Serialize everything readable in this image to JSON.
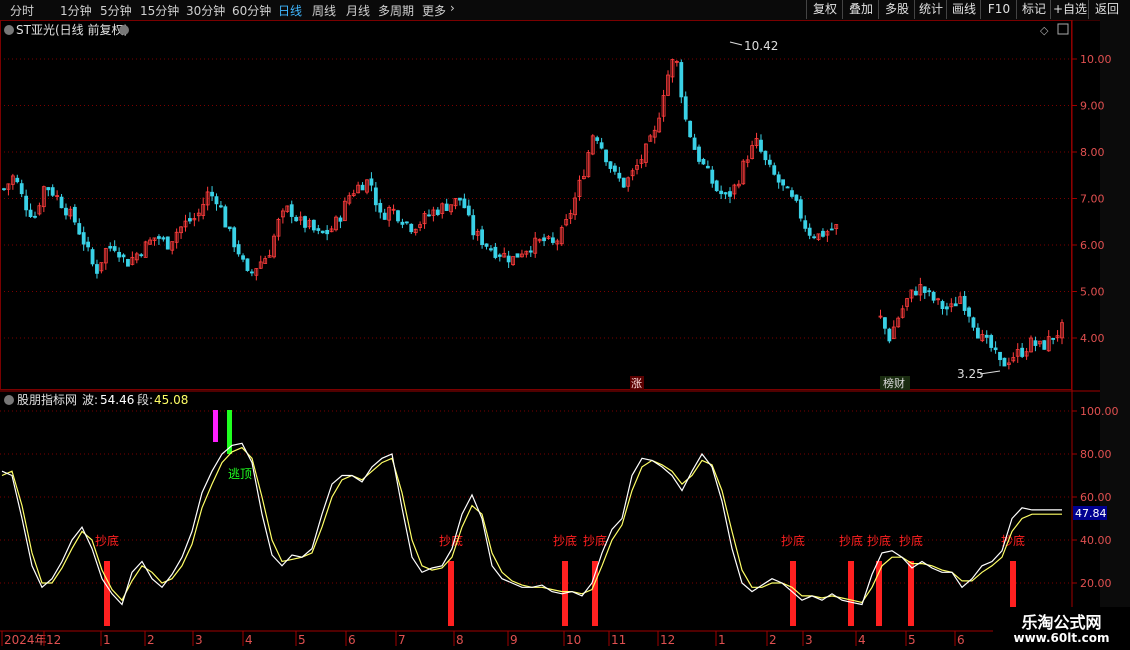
{
  "toolbar": {
    "periods": [
      "分时",
      "1分钟",
      "5分钟",
      "15分钟",
      "30分钟",
      "60分钟",
      "日线",
      "周线",
      "月线",
      "多周期",
      "更多"
    ],
    "active_period": "日线",
    "buttons": [
      "复权",
      "叠加",
      "多股",
      "统计",
      "画线",
      "F10",
      "标记",
      "+自选",
      "返回"
    ]
  },
  "main_panel": {
    "title": "ST亚光(日线 前复权)",
    "high_label": "10.42",
    "low_label": "3.25",
    "event_tag_1": "涨",
    "event_tag_2": "榜财"
  },
  "indicator_panel": {
    "name": "股朋指标网",
    "wave_label": "波:",
    "wave_value": "54.46",
    "segment_label": "段:",
    "segment_value": "45.08",
    "current_value": "47.84",
    "top_signal": "逃顶",
    "bottom_signal": "抄底"
  },
  "colors": {
    "bg": "#000000",
    "grid": "#7a0000",
    "up": "#ff3c3c",
    "down": "#3ad1e6",
    "wave": "#ffffff",
    "segment": "#ffff66",
    "signal_bottom": "#ff2020",
    "signal_top_green": "#20ff20",
    "signal_top_magenta": "#ff20ff"
  },
  "chart_data": [
    {
      "type": "candlestick",
      "title": "ST亚光(日线 前复权)",
      "y_ticks": [
        4.0,
        5.0,
        6.0,
        7.0,
        8.0,
        9.0,
        10.0
      ],
      "ylim": [
        3.0,
        10.8
      ],
      "high": 10.42,
      "low": 3.25,
      "x_tick_labels": [
        "2024年",
        "12",
        "1",
        "2",
        "3",
        "4",
        "5",
        "6",
        "7",
        "8",
        "9",
        "10",
        "11",
        "12",
        "1",
        "2",
        "3",
        "4",
        "5",
        "6"
      ],
      "close_path": [
        7.2,
        7.5,
        6.9,
        6.6,
        7.3,
        7.1,
        6.8,
        6.5,
        6.0,
        5.4,
        5.9,
        6.0,
        5.6,
        5.8,
        6.0,
        6.2,
        6.0,
        6.3,
        6.5,
        6.6,
        7.1,
        7.0,
        6.3,
        5.9,
        5.3,
        5.6,
        5.8,
        6.5,
        6.8,
        6.5,
        6.4,
        6.2,
        6.3,
        6.6,
        7.1,
        7.3,
        7.4,
        6.6,
        6.8,
        6.6,
        6.4,
        6.5,
        6.7,
        6.8,
        6.9,
        7.0,
        6.3,
        6.1,
        5.9,
        5.8,
        5.7,
        5.9,
        6.0,
        6.1,
        6.0,
        6.3,
        6.9,
        7.6,
        8.5,
        8.0,
        7.5,
        7.3,
        7.6,
        8.0,
        8.4,
        9.5,
        10.1,
        8.7,
        8.0,
        7.6,
        7.2,
        7.0,
        7.3,
        7.9,
        8.2,
        7.7,
        7.4,
        7.1,
        6.8,
        6.3,
        6.2,
        6.3,
        6.4,
        null,
        null,
        null,
        4.5,
        4.0,
        4.5,
        4.9,
        5.1,
        4.9,
        4.7,
        4.6,
        4.9,
        4.5,
        4.0,
        3.8,
        3.4,
        3.6,
        3.7,
        3.9,
        3.8,
        4.0,
        4.2
      ]
    },
    {
      "type": "line",
      "title": "股朋指标网",
      "y_ticks": [
        20.0,
        40.0,
        60.0,
        80.0,
        100.0
      ],
      "ylim": [
        5,
        106
      ],
      "current_value": 47.84,
      "series": [
        {
          "name": "波",
          "x": [
            0,
            1,
            2,
            3,
            4,
            5,
            6,
            7,
            8,
            9,
            10,
            11,
            12,
            13,
            14,
            15,
            16,
            17,
            18,
            19,
            20,
            21,
            22,
            23,
            24,
            25,
            26,
            27,
            28,
            29,
            30,
            31,
            32,
            33,
            34,
            35,
            36,
            37,
            38,
            39,
            40,
            41,
            42,
            43,
            44,
            45,
            46,
            47,
            48,
            49,
            50,
            51,
            52,
            53,
            54,
            55,
            56,
            57,
            58,
            59,
            60,
            61,
            62,
            63,
            64,
            65,
            66,
            67,
            68,
            69,
            70,
            71,
            72,
            73,
            74,
            75,
            76,
            77,
            78,
            79,
            80,
            81,
            82,
            83,
            84,
            85,
            86,
            87,
            88,
            89,
            90,
            91,
            92,
            93,
            94,
            95,
            96,
            97,
            98,
            99,
            100,
            101,
            102,
            103,
            104,
            105,
            106
          ],
          "values": [
            72,
            70,
            50,
            28,
            18,
            22,
            30,
            40,
            46,
            36,
            22,
            15,
            10,
            25,
            30,
            22,
            18,
            24,
            32,
            44,
            62,
            72,
            80,
            84,
            85,
            76,
            52,
            33,
            28,
            33,
            32,
            36,
            52,
            66,
            70,
            70,
            67,
            74,
            78,
            80,
            55,
            32,
            25,
            27,
            28,
            36,
            52,
            61,
            50,
            28,
            22,
            20,
            18,
            18,
            19,
            16,
            15,
            16,
            14,
            20,
            34,
            45,
            50,
            70,
            78,
            77,
            74,
            70,
            63,
            72,
            80,
            74,
            58,
            36,
            20,
            16,
            19,
            22,
            20,
            16,
            12,
            14,
            12,
            15,
            12,
            11,
            10,
            24,
            34,
            35,
            32,
            27,
            30,
            27,
            25,
            25,
            18,
            22,
            28,
            30,
            35,
            50,
            55,
            54,
            54,
            54,
            54
          ]
        },
        {
          "name": "段",
          "x": [
            0,
            1,
            2,
            3,
            4,
            5,
            6,
            7,
            8,
            9,
            10,
            11,
            12,
            13,
            14,
            15,
            16,
            17,
            18,
            19,
            20,
            21,
            22,
            23,
            24,
            25,
            26,
            27,
            28,
            29,
            30,
            31,
            32,
            33,
            34,
            35,
            36,
            37,
            38,
            39,
            40,
            41,
            42,
            43,
            44,
            45,
            46,
            47,
            48,
            49,
            50,
            51,
            52,
            53,
            54,
            55,
            56,
            57,
            58,
            59,
            60,
            61,
            62,
            63,
            64,
            65,
            66,
            67,
            68,
            69,
            70,
            71,
            72,
            73,
            74,
            75,
            76,
            77,
            78,
            79,
            80,
            81,
            82,
            83,
            84,
            85,
            86,
            87,
            88,
            89,
            90,
            91,
            92,
            93,
            94,
            95,
            96,
            97,
            98,
            99,
            100,
            101,
            102,
            103,
            104,
            105,
            106
          ],
          "values": [
            70,
            72,
            56,
            34,
            20,
            20,
            27,
            36,
            44,
            40,
            26,
            17,
            12,
            21,
            28,
            25,
            20,
            22,
            28,
            38,
            55,
            66,
            76,
            81,
            83,
            78,
            60,
            40,
            30,
            31,
            32,
            34,
            46,
            60,
            68,
            70,
            68,
            72,
            76,
            78,
            62,
            40,
            28,
            26,
            27,
            32,
            46,
            56,
            52,
            34,
            25,
            21,
            19,
            18,
            18,
            17,
            16,
            16,
            15,
            17,
            28,
            40,
            47,
            63,
            74,
            77,
            75,
            72,
            66,
            70,
            77,
            75,
            63,
            44,
            26,
            18,
            18,
            20,
            20,
            18,
            14,
            14,
            13,
            14,
            13,
            12,
            11,
            18,
            28,
            32,
            32,
            29,
            29,
            28,
            26,
            25,
            21,
            21,
            25,
            28,
            32,
            44,
            50,
            52,
            52,
            52,
            52
          ]
        }
      ],
      "x_tick_labels": [
        "2024年",
        "12",
        "1",
        "2",
        "3",
        "4",
        "5",
        "6",
        "7",
        "8",
        "9",
        "10",
        "11",
        "12",
        "1",
        "2",
        "3",
        "4",
        "5",
        "6"
      ]
    }
  ],
  "watermark": {
    "line1": "乐淘公式网",
    "line2": "www.60lt.com"
  }
}
